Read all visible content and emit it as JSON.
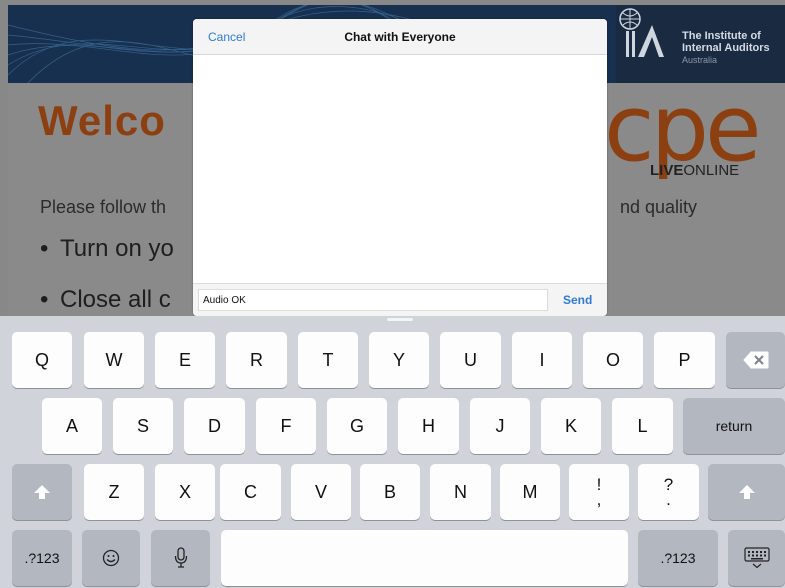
{
  "slide": {
    "logo_lines": [
      "The Institute of",
      "Internal Auditors"
    ],
    "logo_sub": "Australia",
    "welcome": "Welco",
    "cpe": "cpe",
    "live_bold": "LIVE",
    "live_rest": "ONLINE",
    "follow_left": "Please follow th",
    "follow_right": "nd quality",
    "bullets": [
      "Turn on yo",
      "Close all c"
    ]
  },
  "chat": {
    "cancel_label": "Cancel",
    "title": "Chat with Everyone",
    "input_value": "Audio OK",
    "send_label": "Send"
  },
  "keyboard": {
    "row1": [
      "Q",
      "W",
      "E",
      "R",
      "T",
      "Y",
      "U",
      "I",
      "O",
      "P"
    ],
    "row2": [
      "A",
      "S",
      "D",
      "F",
      "G",
      "H",
      "J",
      "K",
      "L"
    ],
    "row3": [
      "Z",
      "X",
      "C",
      "V",
      "B",
      "N",
      "M"
    ],
    "return_label": "return",
    "numbers_label": ".?123",
    "punc1": [
      "!",
      ","
    ],
    "punc2": [
      "?",
      "."
    ],
    "icons": {
      "backspace": "backspace-icon",
      "shift": "shift-icon",
      "emoji": "emoji-icon",
      "mic": "microphone-icon",
      "hide": "keyboard-hide-icon"
    }
  },
  "colors": {
    "accent": "#2f7bd9",
    "slide_orange": "#8c3f10",
    "keyboard_bg": "#d0d4da",
    "key_bg": "#fdfdfe",
    "dark_key_bg": "#b3b7c0"
  }
}
